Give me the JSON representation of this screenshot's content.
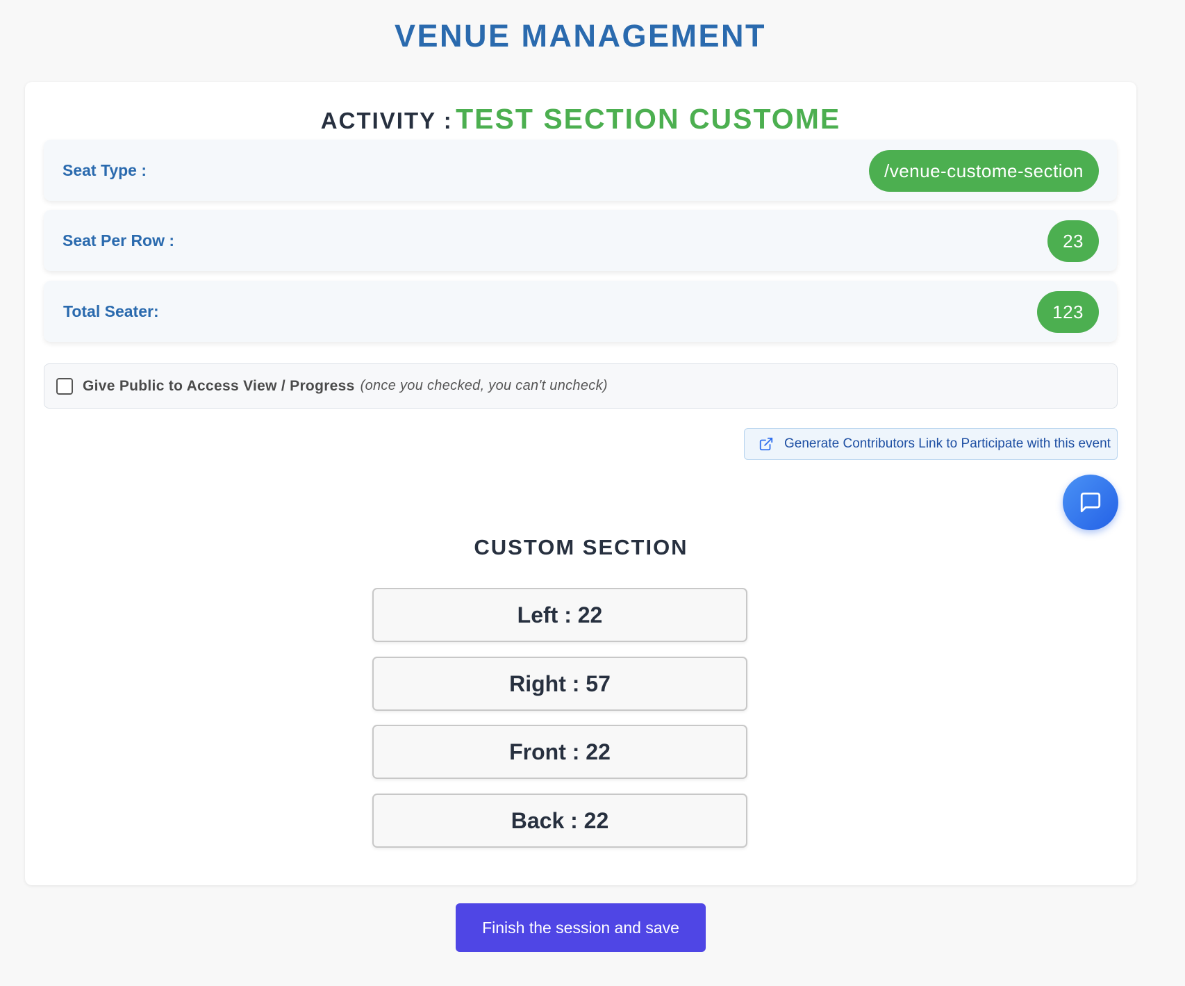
{
  "page": {
    "title": "VENUE MANAGEMENT"
  },
  "activity": {
    "prefix": "ACTIVITY :",
    "name": "TEST SECTION CUSTOME"
  },
  "info_rows": [
    {
      "label": "Seat Type :",
      "value": "/venue-custome-section"
    },
    {
      "label": "Seat Per Row :",
      "value": "23"
    },
    {
      "label": "Total Seater:",
      "value": "123"
    }
  ],
  "public_access": {
    "checked": false,
    "label": "Give Public to Access View / Progress",
    "note": "(once you checked, you can't uncheck)"
  },
  "contributors_link": {
    "icon": "external-link-icon",
    "label": "Generate Contributors Link to Participate with this event"
  },
  "chat_button": {
    "icon": "chat-bubble-icon"
  },
  "custom_section": {
    "title": "CUSTOM SECTION",
    "items": [
      "Left : 22",
      "Right : 57",
      "Front : 22",
      "Back : 22"
    ]
  },
  "finish_button": {
    "label": "Finish the session and save"
  },
  "colors": {
    "title_blue": "#2a6aae",
    "accent_green": "#4caf50",
    "primary_button": "#4f46e5",
    "chat_blue": "#2f6fee"
  }
}
